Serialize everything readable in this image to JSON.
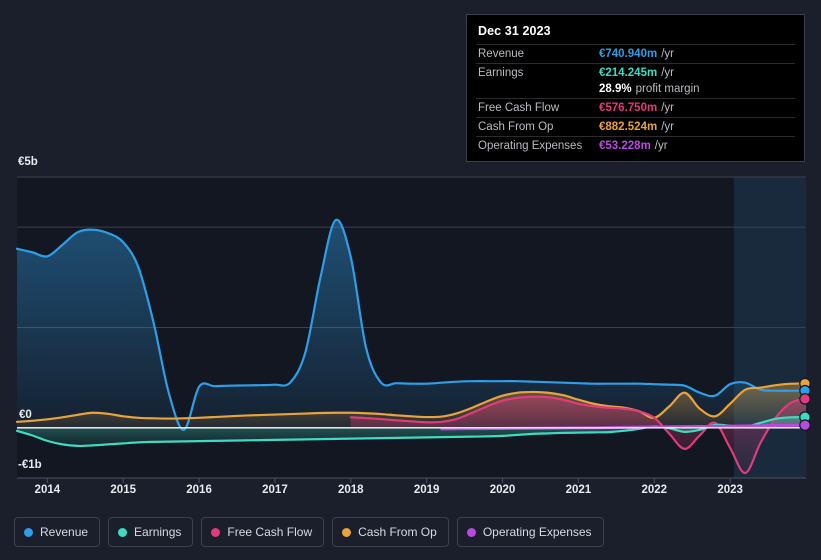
{
  "tooltip": {
    "title": "Dec 31 2023",
    "rows": [
      {
        "label": "Revenue",
        "value": "€740.940m",
        "unit": "/yr",
        "color": "#2f9ee6"
      },
      {
        "label": "Earnings",
        "value": "€214.245m",
        "unit": "/yr",
        "color": "#3ddbc0"
      },
      {
        "label": "",
        "value": "28.9%",
        "unit": "profit margin",
        "color": "#ffffff"
      },
      {
        "label": "Free Cash Flow",
        "value": "€576.750m",
        "unit": "/yr",
        "color": "#e03b7a"
      },
      {
        "label": "Cash From Op",
        "value": "€882.524m",
        "unit": "/yr",
        "color": "#e8a33d"
      },
      {
        "label": "Operating Expenses",
        "value": "€53.228m",
        "unit": "/yr",
        "color": "#b84ae0"
      }
    ]
  },
  "legend": {
    "items": [
      {
        "label": "Revenue",
        "color": "#2f9ee6"
      },
      {
        "label": "Earnings",
        "color": "#3ddbc0"
      },
      {
        "label": "Free Cash Flow",
        "color": "#e03b7a"
      },
      {
        "label": "Cash From Op",
        "color": "#e8a33d"
      },
      {
        "label": "Operating Expenses",
        "color": "#b84ae0"
      }
    ]
  },
  "axis": {
    "y_top": "€5b",
    "y_zero": "€0",
    "y_bottom": "-€1b",
    "x_ticks": [
      "2014",
      "2015",
      "2016",
      "2017",
      "2018",
      "2019",
      "2020",
      "2021",
      "2022",
      "2023"
    ]
  },
  "chart_data": {
    "type": "area",
    "title": "",
    "xlabel": "",
    "ylabel": "",
    "ylim": [
      -1000,
      5000
    ],
    "y_unit": "EUR millions",
    "grid": true,
    "legend_position": "bottom",
    "yticks": [
      5000,
      0,
      -1000
    ],
    "ytick_labels": [
      "€5b",
      "€0",
      "-€1b"
    ],
    "x": [
      "2013.6",
      "2013.8",
      "2014.0",
      "2014.2",
      "2014.4",
      "2014.6",
      "2014.8",
      "2015.0",
      "2015.2",
      "2015.4",
      "2015.6",
      "2015.8",
      "2016.0",
      "2016.2",
      "2016.4",
      "2016.6",
      "2016.8",
      "2017.0",
      "2017.2",
      "2017.4",
      "2017.6",
      "2017.8",
      "2018.0",
      "2018.2",
      "2018.4",
      "2018.6",
      "2018.8",
      "2019.0",
      "2019.2",
      "2019.4",
      "2019.6",
      "2019.8",
      "2020.0",
      "2020.2",
      "2020.4",
      "2020.6",
      "2020.8",
      "2021.0",
      "2021.2",
      "2021.4",
      "2021.6",
      "2021.8",
      "2022.0",
      "2022.2",
      "2022.4",
      "2022.6",
      "2022.8",
      "2023.0",
      "2023.2",
      "2023.4",
      "2023.6",
      "2023.8",
      "2024.0"
    ],
    "x_range": [
      2013.6,
      2024.0
    ],
    "highlight_band": {
      "from": 2023.05,
      "to": 2024.0,
      "label": ""
    },
    "series": [
      {
        "name": "Revenue",
        "color": "#2f9ee6",
        "fill": "rgba(47,158,230,0.16)",
        "values": [
          3570,
          3500,
          3420,
          3650,
          3900,
          3950,
          3880,
          3700,
          3200,
          2100,
          700,
          -40,
          820,
          830,
          840,
          845,
          850,
          860,
          900,
          1500,
          3000,
          4140,
          3400,
          1600,
          900,
          890,
          880,
          880,
          900,
          920,
          930,
          930,
          930,
          930,
          920,
          910,
          900,
          890,
          880,
          880,
          880,
          880,
          870,
          860,
          840,
          700,
          640,
          870,
          900,
          760,
          740,
          740,
          741
        ]
      },
      {
        "name": "Earnings",
        "color": "#3ddbc0",
        "fill": "rgba(61,219,192,0.14)",
        "values": [
          -60,
          -150,
          -260,
          -330,
          -360,
          -350,
          -330,
          -310,
          -290,
          -280,
          -275,
          -270,
          -265,
          -260,
          -255,
          -250,
          -245,
          -240,
          -235,
          -230,
          -225,
          -220,
          -215,
          -210,
          -205,
          -200,
          -195,
          -190,
          -185,
          -180,
          -175,
          -170,
          -160,
          -140,
          -120,
          -110,
          -100,
          -95,
          -90,
          -85,
          -60,
          -20,
          30,
          -10,
          -80,
          -40,
          60,
          40,
          20,
          100,
          180,
          210,
          214
        ]
      },
      {
        "name": "Free Cash Flow",
        "color": "#e03b7a",
        "fill": "rgba(224,59,122,0.20)",
        "values": [
          null,
          null,
          null,
          null,
          null,
          null,
          null,
          null,
          null,
          null,
          null,
          null,
          null,
          null,
          null,
          null,
          null,
          null,
          null,
          null,
          null,
          null,
          210,
          195,
          175,
          150,
          130,
          110,
          120,
          180,
          300,
          430,
          540,
          600,
          620,
          610,
          560,
          480,
          430,
          400,
          380,
          330,
          200,
          -120,
          -420,
          -150,
          100,
          -400,
          -900,
          -300,
          200,
          500,
          577
        ]
      },
      {
        "name": "Cash From Op",
        "color": "#e8a33d",
        "fill": "rgba(232,163,61,0.18)",
        "values": [
          120,
          140,
          170,
          210,
          260,
          300,
          280,
          230,
          200,
          190,
          185,
          190,
          200,
          215,
          230,
          245,
          255,
          265,
          275,
          285,
          295,
          300,
          300,
          290,
          275,
          250,
          230,
          215,
          225,
          290,
          400,
          530,
          640,
          700,
          715,
          700,
          650,
          560,
          480,
          430,
          400,
          330,
          200,
          430,
          700,
          380,
          230,
          480,
          760,
          800,
          850,
          880,
          882
        ]
      },
      {
        "name": "Operating Expenses",
        "color": "#b84ae0",
        "fill": "rgba(184,74,224,0.22)",
        "values": [
          null,
          null,
          null,
          null,
          null,
          null,
          null,
          null,
          null,
          null,
          null,
          null,
          null,
          null,
          null,
          null,
          null,
          null,
          null,
          null,
          null,
          null,
          null,
          null,
          null,
          null,
          null,
          null,
          -20,
          -18,
          -16,
          -14,
          -12,
          -10,
          -8,
          -6,
          -4,
          -2,
          0,
          4,
          8,
          12,
          16,
          20,
          24,
          26,
          28,
          32,
          36,
          40,
          46,
          50,
          53
        ]
      }
    ],
    "endpoint_markers": [
      {
        "series": "Cash From Op",
        "color": "#e8a33d",
        "value": 882.524
      },
      {
        "series": "Revenue",
        "color": "#2f9ee6",
        "value": 740.94
      },
      {
        "series": "Free Cash Flow",
        "color": "#e03b7a",
        "value": 576.75
      },
      {
        "series": "Earnings",
        "color": "#3ddbc0",
        "value": 214.245
      },
      {
        "series": "Operating Expenses",
        "color": "#b84ae0",
        "value": 53.228
      }
    ]
  }
}
